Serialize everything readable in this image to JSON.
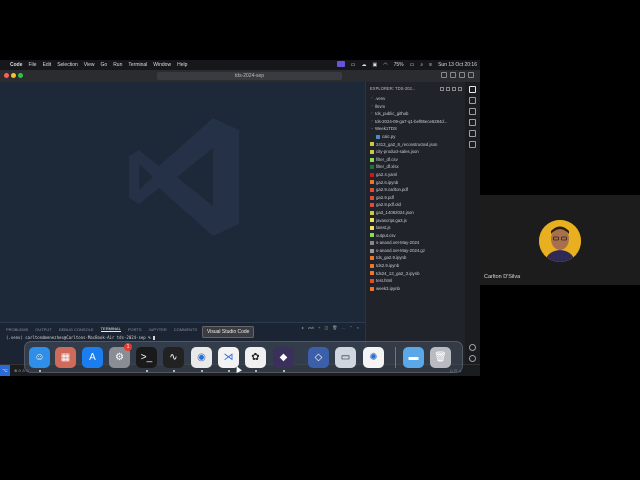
{
  "menubar": {
    "app": "Code",
    "items": [
      "File",
      "Edit",
      "Selection",
      "View",
      "Go",
      "Run",
      "Terminal",
      "Window",
      "Help"
    ],
    "battery": "75%",
    "datetime": "Sun 13 Oct  20:16"
  },
  "window": {
    "search": "tds-2024-sep"
  },
  "panel": {
    "tabs": [
      "PROBLEMS",
      "OUTPUT",
      "DEBUG CONSOLE",
      "TERMINAL",
      "PORTS",
      "JUPYTER",
      "COMMENTS"
    ],
    "active_tab": "TERMINAL",
    "terminal_shell": "zsh",
    "terminal_prompt": "(.venv) carltondmenezhes@Carltons-MacBook-Air tds-2024-sep % "
  },
  "explorer": {
    "header": "EXPLORER: TDS-202...",
    "items": [
      {
        "name": ".venv",
        "type": "folder",
        "indent": 0
      },
      {
        "name": "llnvm",
        "type": "folder",
        "indent": 0
      },
      {
        "name": "tds_public_github",
        "type": "folder",
        "indent": 0
      },
      {
        "name": "tds-2024-09-ga7-q1-bef86ece6284d...",
        "type": "folder",
        "indent": 0
      },
      {
        "name": "Week1TDS",
        "type": "folder-open",
        "indent": 0
      },
      {
        "name": "calc.py",
        "type": "py",
        "indent": 1
      },
      {
        "name": "2413_ga2_8_reconstructed.json",
        "type": "json",
        "indent": 0
      },
      {
        "name": "city-product-sales.json",
        "type": "json",
        "indent": 0
      },
      {
        "name": "filter_df.csv",
        "type": "csv",
        "indent": 0
      },
      {
        "name": "filter_df.xlsx",
        "type": "xlsx",
        "indent": 0
      },
      {
        "name": "ga2.4.yaml",
        "type": "yaml",
        "indent": 0
      },
      {
        "name": "ga2.6.ipynb",
        "type": "ipynb",
        "indent": 0
      },
      {
        "name": "ga2.9.carlton.pdf",
        "type": "pdf",
        "indent": 0
      },
      {
        "name": "ga2.9.pdf",
        "type": "pdf",
        "indent": 0
      },
      {
        "name": "ga2.8.pdf.old",
        "type": "pdf",
        "indent": 0
      },
      {
        "name": "ga3_14082024.json",
        "type": "json",
        "indent": 0
      },
      {
        "name": "javascript.ga3.js",
        "type": "js",
        "indent": 0
      },
      {
        "name": "latest.js",
        "type": "js",
        "indent": 0
      },
      {
        "name": "output.csv",
        "type": "csv",
        "indent": 0
      },
      {
        "name": "s-anand.net-May-2024",
        "type": "file",
        "indent": 0
      },
      {
        "name": "s-anand.net-May-2024.gz",
        "type": "gz",
        "indent": 0
      },
      {
        "name": "tds_ga2.9.ipynb",
        "type": "ipynb",
        "indent": 0
      },
      {
        "name": "tds2.9.ipynb",
        "type": "ipynb",
        "indent": 0
      },
      {
        "name": "tds24_13_ga2_3.ipynb",
        "type": "ipynb",
        "indent": 0
      },
      {
        "name": "test.html",
        "type": "html",
        "indent": 0
      },
      {
        "name": "week3.ipynb",
        "type": "ipynb",
        "indent": 0
      }
    ]
  },
  "dock": {
    "tooltip": "Visual Studio Code",
    "notification_count": "1",
    "apps": [
      {
        "name": "finder",
        "glyph": "☺",
        "color": "#2f8ee8"
      },
      {
        "name": "launchpad",
        "glyph": "▦",
        "color": "#d06a5a"
      },
      {
        "name": "app-store",
        "glyph": "A",
        "color": "#1b7ef0"
      },
      {
        "name": "system-settings",
        "glyph": "⚙",
        "color": "#8a8d93"
      },
      {
        "name": "terminal",
        "glyph": ">_",
        "color": "#1a1a1a"
      },
      {
        "name": "activity-monitor",
        "glyph": "∿",
        "color": "#222"
      },
      {
        "name": "chrome",
        "glyph": "◉",
        "color": "#e9e9e9"
      },
      {
        "name": "vscode",
        "glyph": "⋊",
        "color": "#f2f2f2"
      },
      {
        "name": "chatgpt",
        "glyph": "✿",
        "color": "#f0f0f0"
      },
      {
        "name": "obsidian",
        "glyph": "◆",
        "color": "#3b2f5c"
      },
      {
        "name": "sketch",
        "glyph": "◇",
        "color": "#3b5fa8"
      },
      {
        "name": "preview",
        "glyph": "▭",
        "color": "#cfd6df"
      },
      {
        "name": "photos",
        "glyph": "✺",
        "color": "#f4f4f4"
      },
      {
        "name": "downloads-folder",
        "glyph": "▬",
        "color": "#5aa8e8"
      },
      {
        "name": "trash",
        "glyph": "🗑",
        "color": "#b8bcc2"
      }
    ]
  },
  "statusbar": {
    "left": "⊗ 0 ⚠ 0",
    "right": "{} ⊡ ☼"
  },
  "participant": {
    "name": "Carlton D'Silva"
  }
}
